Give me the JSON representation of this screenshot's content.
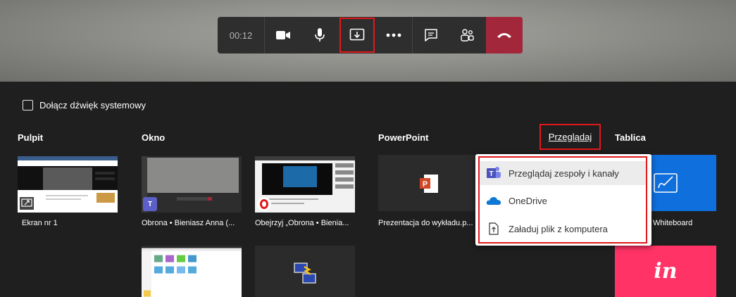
{
  "call_controls": {
    "timer": "00:12",
    "buttons": [
      "camera-icon",
      "microphone-icon",
      "share-tray-icon",
      "more-options-icon",
      "chat-icon",
      "participants-icon",
      "hang-up-icon"
    ]
  },
  "share_tray": {
    "system_audio_label": "Dołącz dźwięk systemowy",
    "sections": {
      "desktop": "Pulpit",
      "window": "Okno",
      "powerpoint": "PowerPoint",
      "browse": "Przeglądaj",
      "whiteboard": "Tablica"
    },
    "desktop_items": [
      "Ekran nr 1"
    ],
    "window_items": [
      "Obrona • Bieniasz Anna (...",
      "Obejrzyj „Obrona • Bienia..."
    ],
    "powerpoint_items": [
      "Prezentacja do wykładu.p..."
    ],
    "whiteboard_items": [
      "Whiteboard"
    ]
  },
  "browse_menu": {
    "items": [
      {
        "label": "Przeglądaj zespoły i kanały",
        "icon": "teams-icon"
      },
      {
        "label": "OneDrive",
        "icon": "onedrive-icon"
      },
      {
        "label": "Załaduj plik z komputera",
        "icon": "upload-file-icon"
      }
    ]
  },
  "colors": {
    "hangup": "#a3273a",
    "highlight_border": "#e0191c",
    "whiteboard_tile": "#0f6fdc",
    "invision_tile": "#ff3366"
  },
  "invision_logo": "in"
}
